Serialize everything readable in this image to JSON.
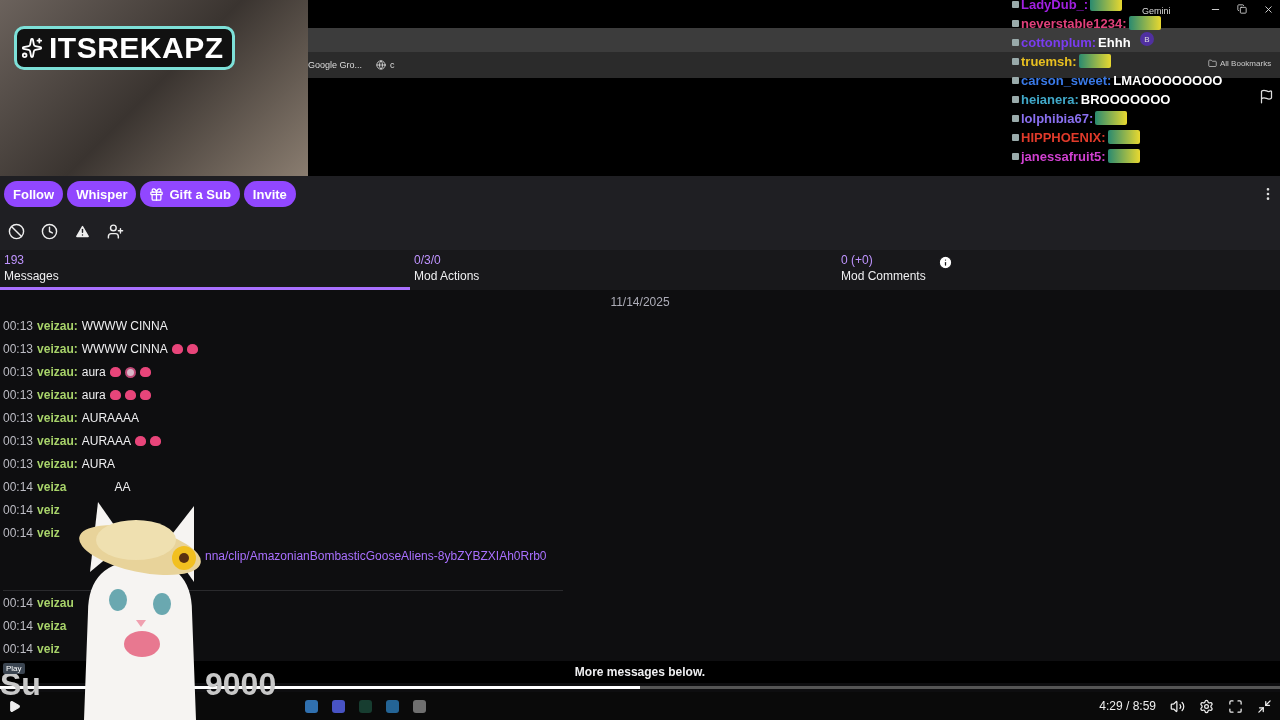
{
  "stream_overlay": {
    "title": "ITSREKAPZ"
  },
  "browser": {
    "tab_strip_label": "Gemini",
    "bookmarks": [
      {
        "label": "Google Gro...",
        "kind": "text"
      },
      {
        "label": "c",
        "kind": "globe"
      }
    ],
    "all_bookmarks": "All Bookmarks",
    "profile": "B"
  },
  "live_chat": [
    {
      "kind": "emote",
      "user": "LadyDub_:",
      "color": "#a020e0"
    },
    {
      "kind": "emote",
      "user": "neverstable1234:",
      "color": "#e0407a"
    },
    {
      "kind": "text",
      "user": "cottonplum:",
      "color": "#7a3cf0",
      "text": "Ehhh"
    },
    {
      "kind": "emote",
      "user": "truemsh:",
      "color": "#e8c020"
    },
    {
      "kind": "text",
      "user": "carson_sweet:",
      "color": "#3a7ae8",
      "text": "LMAOOOOOOOO"
    },
    {
      "kind": "text",
      "user": "heianera:",
      "color": "#40a8c8",
      "text": "BROOOOOOO"
    },
    {
      "kind": "emote",
      "user": "lolphibia67:",
      "color": "#8a70f0"
    },
    {
      "kind": "emote",
      "user": "HIPPHOENIX:",
      "color": "#e03a2a"
    },
    {
      "kind": "emote",
      "user": "janessafruit5:",
      "color": "#d040d0"
    }
  ],
  "actions": [
    {
      "label": "Follow",
      "kind": "plain"
    },
    {
      "label": "Whisper",
      "kind": "plain"
    },
    {
      "label": "Gift a Sub",
      "kind": "gift"
    },
    {
      "label": "Invite",
      "kind": "plain"
    }
  ],
  "tabs": [
    {
      "count": "193",
      "label": "Messages",
      "selected": true,
      "info": false
    },
    {
      "count": "0/3/0",
      "label": "Mod Actions",
      "selected": false,
      "info": false
    },
    {
      "count": "0 (+0)",
      "label": "Mod Comments",
      "selected": false,
      "info": true
    }
  ],
  "date": "11/14/2025",
  "messages": [
    {
      "time": "00:13",
      "user": "veizau:",
      "text": "WWWW CINNA"
    },
    {
      "time": "00:13",
      "user": "veizau:",
      "text": "WWWW CINNA",
      "emotes": [
        {
          "kind": "heart"
        },
        {
          "kind": "heart"
        }
      ]
    },
    {
      "time": "00:13",
      "user": "veizau:",
      "text": "aura",
      "emotes": [
        {
          "kind": "heart"
        },
        {
          "kind": "eye"
        },
        {
          "kind": "heart"
        }
      ]
    },
    {
      "time": "00:13",
      "user": "veizau:",
      "text": "aura",
      "emotes": [
        {
          "kind": "heart"
        },
        {
          "kind": "heart"
        },
        {
          "kind": "heart"
        }
      ]
    },
    {
      "time": "00:13",
      "user": "veizau:",
      "text": "AURAAAA"
    },
    {
      "time": "00:13",
      "user": "veizau:",
      "text": "AURAAA",
      "emotes": [
        {
          "kind": "heart"
        },
        {
          "kind": "heart"
        }
      ]
    },
    {
      "time": "00:13",
      "user": "veizau:",
      "text": "AURA"
    },
    {
      "time": "00:14",
      "user": "veiza",
      "tail": "AA"
    },
    {
      "time": "00:14",
      "user": "veiz"
    },
    {
      "time": "00:14",
      "user": "veiz"
    },
    {
      "kind": "clip",
      "link": "nna/clip/AmazonianBombasticGooseAliens-8ybZYBZXIAh0Rrb0"
    },
    {
      "time": "00:14",
      "user": "veizau"
    },
    {
      "time": "00:14",
      "user": "veiza"
    },
    {
      "time": "00:14",
      "user": "veiz"
    }
  ],
  "more_messages": "More messages below.",
  "subtitle": [
    "Su",
    "9000"
  ],
  "player": {
    "tooltip": "Play",
    "level": 0.5,
    "time": "4:29 / 8:59"
  }
}
